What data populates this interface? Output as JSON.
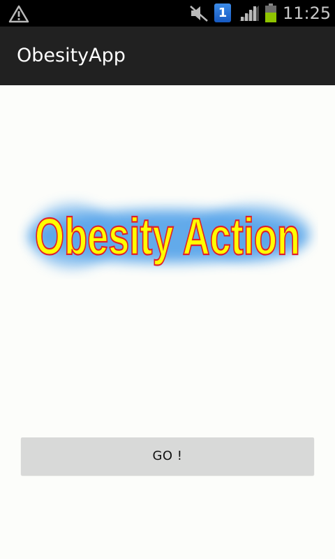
{
  "status_bar": {
    "sim_label": "1",
    "time": "11:25",
    "icons": [
      "warning-icon",
      "mute-icon",
      "sim-icon",
      "signal-icon",
      "battery-icon"
    ]
  },
  "action_bar": {
    "title": "ObesityApp"
  },
  "main": {
    "logo_text": "Obesity Action",
    "go_button_label": "GO !"
  },
  "colors": {
    "action_bar_bg": "#212121",
    "background": "#fcfdfa",
    "logo_fill": "#ffff00",
    "logo_stroke": "#e0202a",
    "logo_glow": "#5aa6ea",
    "button_bg": "#d8d9d8"
  }
}
